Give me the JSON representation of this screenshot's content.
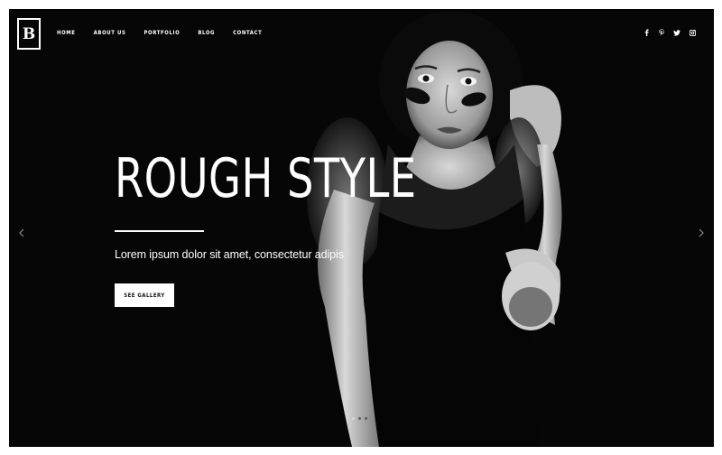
{
  "header": {
    "logo_letter": "B",
    "nav": [
      {
        "label": "HOME"
      },
      {
        "label": "ABOUT US"
      },
      {
        "label": "PORTFOLIO"
      },
      {
        "label": "BLOG"
      },
      {
        "label": "CONTACT"
      }
    ],
    "social_icons": [
      "facebook-icon",
      "pinterest-icon",
      "twitter-icon",
      "instagram-icon"
    ]
  },
  "hero": {
    "title": "ROUGH STYLE",
    "subtitle": "Lorem ipsum dolor sit amet, consectetur adipis",
    "cta_label": "SEE GALLERY"
  },
  "slider": {
    "slide_count": 3,
    "active_index": 0
  },
  "colors": {
    "background": "#060607",
    "text": "#ffffff",
    "button_bg": "#ffffff",
    "button_text": "#111111"
  }
}
